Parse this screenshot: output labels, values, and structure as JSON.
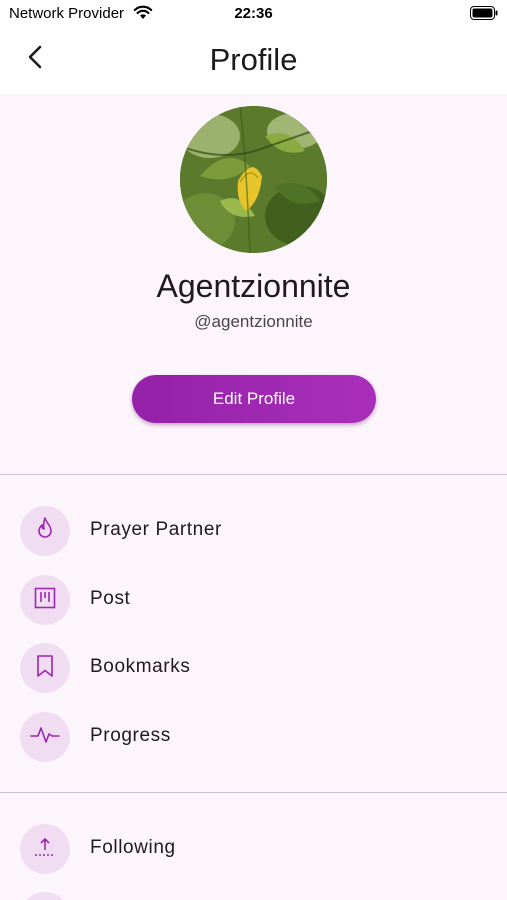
{
  "status_bar": {
    "carrier": "Network Provider",
    "time": "22:36"
  },
  "header": {
    "title": "Profile",
    "back_icon": "chevron-left-icon"
  },
  "profile": {
    "name": "Agentzionnite",
    "handle": "@agentzionnite",
    "edit_button_label": "Edit Profile"
  },
  "menu_section_1": {
    "items": [
      {
        "label": "Prayer Partner",
        "icon": "flame-icon"
      },
      {
        "label": "Post",
        "icon": "post-board-icon"
      },
      {
        "label": "Bookmarks",
        "icon": "bookmark-icon"
      },
      {
        "label": "Progress",
        "icon": "activity-icon"
      }
    ]
  },
  "menu_section_2": {
    "items": [
      {
        "label": "Following",
        "icon": "upload-icon"
      }
    ]
  },
  "colors": {
    "accent": "#9c27b0",
    "background": "#fdf5fc",
    "icon_circle": "#f1ddf1"
  }
}
